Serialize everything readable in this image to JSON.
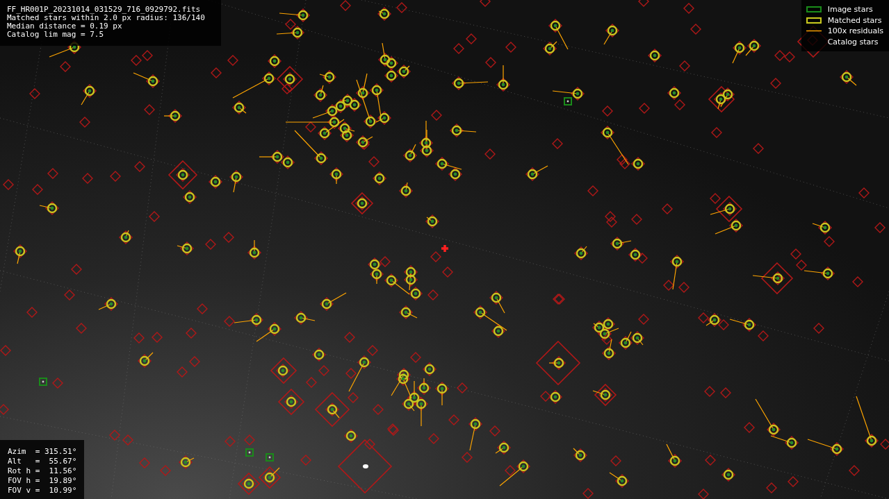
{
  "image_info": [
    "FF_HR001P_20231014_031529_716_0929792.fits",
    "Matched stars within 2.0 px radius: 136/140",
    "Median distance = 0.19 px",
    "Catalog lim mag = 7.5"
  ],
  "legend": [
    {
      "kind": "image",
      "label": "Image stars",
      "color": "#1a8a1a"
    },
    {
      "kind": "matched",
      "label": "Matched stars",
      "color": "#c8c81e"
    },
    {
      "kind": "residual",
      "label": "100x residuals",
      "color": "#ffa500"
    },
    {
      "kind": "catalog",
      "label": "Catalog stars"
    }
  ],
  "pointing": [
    "Azim  = 315.51°",
    "Alt   =  55.67°",
    "Rot h =  11.56°",
    "FOV h =  19.89°",
    "FOV v =  10.99°"
  ]
}
